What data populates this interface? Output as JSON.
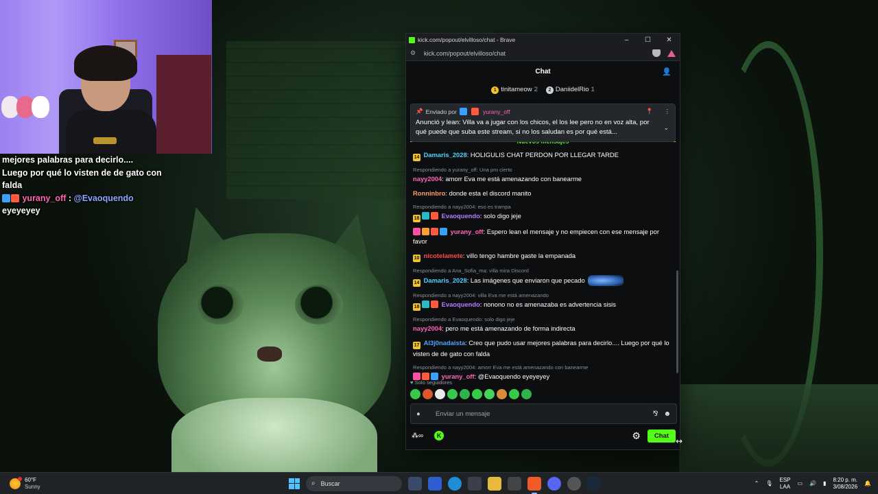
{
  "overlay_chat": {
    "line1": "mejores palabras para decirlo....",
    "line2": "Luego por qué lo visten de de gato con",
    "line3": "falda",
    "user": "yurany_off",
    "sep": " : ",
    "mention": "@Evaoquendo",
    "line5": "eyeyeyey"
  },
  "browser": {
    "title": "kick.com/popout/elvilloso/chat - Brave",
    "url": "kick.com/popout/elvilloso/chat",
    "controls": {
      "minimize": "–",
      "maximize": "☐",
      "close": "✕"
    }
  },
  "chat": {
    "header": "Chat",
    "top_gifters": [
      {
        "rank": "1",
        "name": "tinitameow",
        "count": "2"
      },
      {
        "rank": "2",
        "name": "DaniidelRio",
        "count": "1"
      }
    ],
    "pinned": {
      "sent_by": "Enviado por",
      "user": "yurany_off",
      "text": "Anunció y lean: Villa va a jugar con los chicos, el los lee pero no en voz alta, por qué puede que suba este stream, si no los saludan es por qué está..."
    },
    "new_messages": "Nuevos mensajes",
    "messages": [
      {
        "reply": "",
        "badge": "14",
        "user": "Damaris_2028",
        "color": "#4fd2ff",
        "text": "HOLIGULIS CHAT PERDON POR LLEGAR TARDE"
      },
      {
        "reply": "Respondiendo a yurany_off: Una pro cierto",
        "badge": "",
        "user": "nayy2004",
        "color": "#ff66b8",
        "text": "amorr Eva me está amenazando con banearme"
      },
      {
        "reply": "",
        "badge": "",
        "user": "Ronninbro",
        "color": "#ff9e6b",
        "text": "donde esta el discord manito"
      },
      {
        "reply": "Respondiendo a nayy2004: eso es trampa",
        "badge": "18",
        "user": "Evaoquendo",
        "color": "#b57bff",
        "text": "solo digo jeje"
      },
      {
        "reply": "",
        "badge": "",
        "user": "yurany_off",
        "color": "#ff66b8",
        "text": "Espero lean el mensaje y no empiecen con ese mensaje por favor"
      },
      {
        "reply": "",
        "badge": "10",
        "user": "nicotelamete",
        "color": "#ff4b4b",
        "text": "villo tengo hambre gaste la empanada"
      },
      {
        "reply": "Respondiendo a Ana_Sofia_ma: villa mira Discord",
        "badge": "14",
        "user": "Damaris_2028",
        "color": "#4fd2ff",
        "text": "Las imágenes que enviaron que pecado"
      },
      {
        "reply": "Respondiendo a nayy2004: villa Eva me está amenazando",
        "badge": "18",
        "user": "Evaoquendo",
        "color": "#b57bff",
        "text": "nonono no es amenazaba es advertencia sisis"
      },
      {
        "reply": "Respondiendo a Evaoquendo: solo digo jeje",
        "badge": "",
        "user": "nayy2004",
        "color": "#ff66b8",
        "text": "pero me está amenazando de forma indirecta"
      },
      {
        "reply": "",
        "badge": "17",
        "user": "Al3j0nadaista",
        "color": "#4fa3ff",
        "text": "Creo que pudo usar mejores palabras para decirlo.... Luego por qué lo visten de de gato con falda"
      },
      {
        "reply": "Respondiendo a nayy2004: amorr Eva me está amenazando con banearme",
        "badge": "",
        "user": "yurany_off",
        "color": "#ff66b8",
        "text": "@Evaoquendo eyeyeyey"
      }
    ],
    "followers_only": "Solo seguidores",
    "input_placeholder": "Enviar un mensaje",
    "infinity": "∞",
    "send_label": "Chat"
  },
  "taskbar": {
    "temp": "60°F",
    "condition": "Sunny",
    "search": "Buscar",
    "lang1": "ESP",
    "lang2": "LAA",
    "time": "8:20 p. m.",
    "date": "3/08/2026"
  }
}
